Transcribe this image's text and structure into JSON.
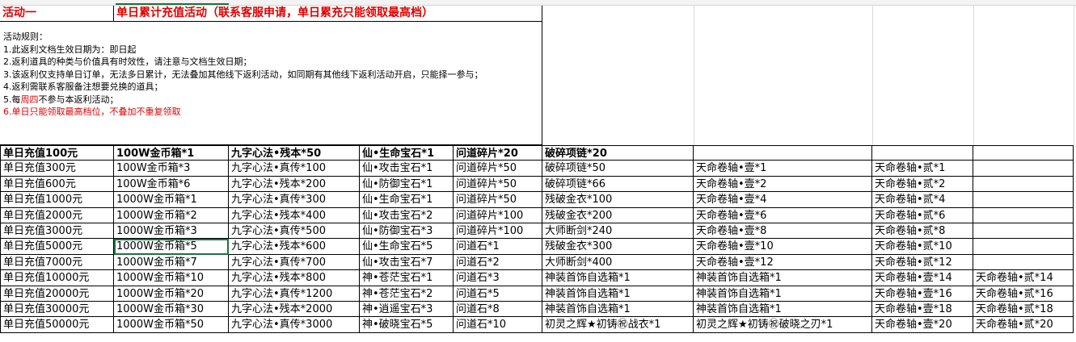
{
  "header": {
    "activity_label": "活动一",
    "activity_title": "单日累计充值活动（联系客服申请，单日累充只能领取最高档）"
  },
  "rules": {
    "heading": "活动规则：",
    "line1": "1.此返利文档生效日期为：即日起",
    "line2": "2.返利道具的种类与价值具有时效性，请注意与文档生效日期；",
    "line3": "3.该返利仅支持单日订单，无法多日累计，无法叠加其他线下返利活动，如同期有其他线下返利活动开启，只能择一参与；",
    "line4": "4.返利需联系客服备注想要兑换的道具；",
    "line5_prefix": "5.每",
    "line5_day": "周四",
    "line5_suffix": "不参与本返利活动；",
    "line6": "6.单日只能领取最高档位，不叠加不重复领取"
  },
  "tiers": [
    [
      "单日充值100元",
      "100W金币箱*1",
      "九字心法•残本*50",
      "仙•生命宝石*1",
      "问道碎片*20",
      "破碎项链*20",
      "",
      "",
      ""
    ],
    [
      "单日充值300元",
      "100W金币箱*3",
      "九字心法•真传*100",
      "仙•攻击宝石*1",
      "问道碎片*50",
      "破碎项链*50",
      "天命卷轴•壹*1",
      "天命卷轴•贰*1",
      ""
    ],
    [
      "单日充值600元",
      "100W金币箱*6",
      "九字心法•残本*200",
      "仙•防御宝石*1",
      "问道碎片*50",
      "破碎项链*66",
      "天命卷轴•壹*2",
      "天命卷轴•贰*2",
      ""
    ],
    [
      "单日充值1000元",
      "1000W金币箱*1",
      "九字心法•真传*300",
      "仙•生命宝石*1",
      "问道碎片*50",
      "残破金衣*100",
      "天命卷轴•壹*4",
      "天命卷轴•贰*4",
      ""
    ],
    [
      "单日充值2000元",
      "1000W金币箱*2",
      "九字心法•残本*400",
      "仙•攻击宝石*2",
      "问道碎片*100",
      "残破金衣*200",
      "天命卷轴•壹*6",
      "天命卷轴•贰*6",
      ""
    ],
    [
      "单日充值3000元",
      "1000W金币箱*3",
      "九字心法•真传*500",
      "仙•防御宝石*3",
      "问道碎片*100",
      "大师断剑*240",
      "天命卷轴•壹*8",
      "天命卷轴•贰*8",
      ""
    ],
    [
      "单日充值5000元",
      "1000W金币箱*5",
      "九字心法•残本*600",
      "仙•生命宝石*5",
      "问道石*1",
      "残破金衣*300",
      "天命卷轴•壹*10",
      "天命卷轴•贰*10",
      ""
    ],
    [
      "单日充值7000元",
      "1000W金币箱*7",
      "九字心法•真传*700",
      "仙•攻击宝石*7",
      "问道石*2",
      "大师断剑*400",
      "天命卷轴•壹*12",
      "天命卷轴•贰*12",
      ""
    ],
    [
      "单日充值10000元",
      "1000W金币箱*10",
      "九字心法•残本*800",
      "神•苍茫宝石*1",
      "问道石*3",
      "神装首饰自选箱*1",
      "神装首饰自选箱*1",
      "天命卷轴•壹*14",
      "天命卷轴•贰*14"
    ],
    [
      "单日充值20000元",
      "1000W金币箱*20",
      "九字心法•真传*1200",
      "神•苍茫宝石*2",
      "问道石*5",
      "神装首饰自选箱*1",
      "神装首饰自选箱*1",
      "天命卷轴•壹*16",
      "天命卷轴•贰*16"
    ],
    [
      "单日充值30000元",
      "1000W金币箱*30",
      "九字心法•残本*2000",
      "神•逍遥宝石*3",
      "问道石*8",
      "神装首饰自选箱*1",
      "神装首饰自选箱*1",
      "天命卷轴•壹*18",
      "天命卷轴•贰*18"
    ],
    [
      "单日充值50000元",
      "1000W金币箱*50",
      "九字心法•真传*3000",
      "神•破晓宝石*5",
      "问道石*10",
      "初灵之辉★初铸㊗战衣*1",
      "初灵之辉★初铸㊗破晓之刃*1",
      "天命卷轴•壹*20",
      "天命卷轴•贰*20"
    ]
  ]
}
